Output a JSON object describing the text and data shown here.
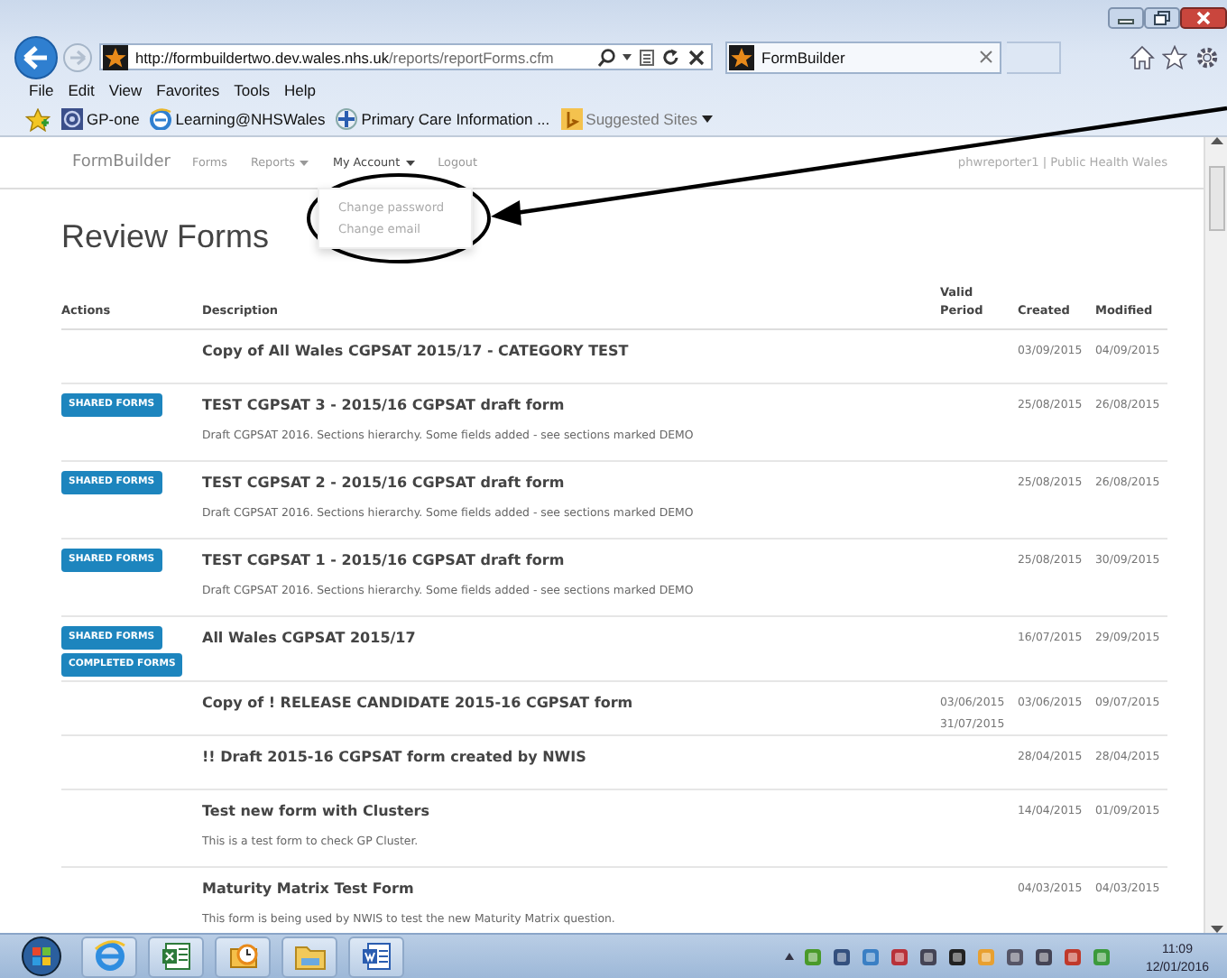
{
  "browser": {
    "url_host": "http://formbuildertwo.dev.wales.nhs.uk",
    "url_path": "/reports/reportForms.cfm",
    "tab_title": "FormBuilder",
    "menu": [
      "File",
      "Edit",
      "View",
      "Favorites",
      "Tools",
      "Help"
    ],
    "favorites": [
      {
        "kind": "gpone",
        "label": "GP-one",
        "greyed": false,
        "dropdown": false
      },
      {
        "kind": "ie",
        "label": "Learning@NHSWales",
        "greyed": false,
        "dropdown": false
      },
      {
        "kind": "cross",
        "label": "Primary Care Information ...",
        "greyed": false,
        "dropdown": false
      },
      {
        "kind": "bing",
        "label": "Suggested Sites",
        "greyed": true,
        "dropdown": true
      }
    ]
  },
  "navbar": {
    "brand": "FormBuilder",
    "items": [
      {
        "label": "Forms",
        "dropdown": false,
        "open": false
      },
      {
        "label": "Reports",
        "dropdown": true,
        "open": false
      },
      {
        "label": "My Account",
        "dropdown": true,
        "open": true
      },
      {
        "label": "Logout",
        "dropdown": false,
        "open": false
      }
    ],
    "dropdown_items": [
      "Change password",
      "Change email"
    ],
    "user": "phwreporter1 | Public Health Wales"
  },
  "page_title": "Review Forms",
  "table": {
    "columns": [
      "Actions",
      "Description",
      "Valid Period",
      "Created",
      "Modified"
    ],
    "rows": [
      {
        "actions": [],
        "title": "Copy of All Wales CGPSAT 2015/17 - CATEGORY TEST",
        "created": "03/09/2015",
        "modified": "04/09/2015"
      },
      {
        "actions": [
          "SHARED FORMS"
        ],
        "title": "TEST CGPSAT 3 - 2015/16 CGPSAT draft form",
        "description": "Draft CGPSAT 2016. Sections hierarchy. Some fields added - see sections marked DEMO",
        "created": "25/08/2015",
        "modified": "26/08/2015"
      },
      {
        "actions": [
          "SHARED FORMS"
        ],
        "title": "TEST CGPSAT 2 - 2015/16 CGPSAT draft form",
        "description": "Draft CGPSAT 2016. Sections hierarchy. Some fields added - see sections marked DEMO",
        "created": "25/08/2015",
        "modified": "26/08/2015"
      },
      {
        "actions": [
          "SHARED FORMS"
        ],
        "title": "TEST CGPSAT 1 - 2015/16 CGPSAT draft form",
        "description": "Draft CGPSAT 2016. Sections hierarchy. Some fields added - see sections marked DEMO",
        "created": "25/08/2015",
        "modified": "30/09/2015"
      },
      {
        "actions": [
          "SHARED FORMS",
          "COMPLETED FORMS"
        ],
        "title": "All Wales CGPSAT 2015/17",
        "created": "16/07/2015",
        "modified": "29/09/2015"
      },
      {
        "actions": [],
        "title": "Copy of ! RELEASE CANDIDATE 2015-16 CGPSAT form",
        "valid_period": [
          "03/06/2015",
          "31/07/2015"
        ],
        "created": "03/06/2015",
        "modified": "09/07/2015"
      },
      {
        "actions": [],
        "title": "!! Draft 2015-16 CGPSAT form created by NWIS",
        "created": "28/04/2015",
        "modified": "28/04/2015"
      },
      {
        "actions": [],
        "title": "Test new form with Clusters",
        "description": "This is a test form to check GP Cluster.",
        "created": "14/04/2015",
        "modified": "01/09/2015"
      },
      {
        "actions": [],
        "title": "Maturity Matrix Test Form",
        "description": "This form is being used by NWIS to test the new Maturity Matrix question.",
        "created": "04/03/2015",
        "modified": "04/03/2015"
      }
    ]
  },
  "taskbar": {
    "time": "11:09",
    "date": "12/01/2016"
  }
}
